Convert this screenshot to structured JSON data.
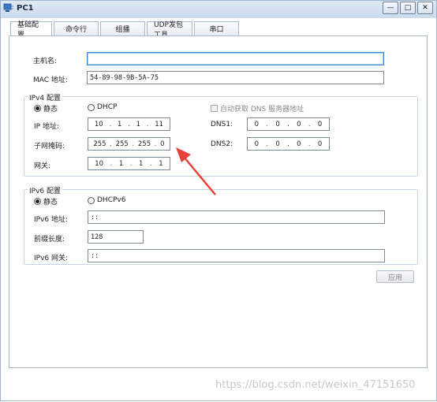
{
  "window": {
    "title": "PC1"
  },
  "tabs": [
    "基础配置",
    "命令行",
    "组播",
    "UDP发包工具",
    "串口"
  ],
  "basic": {
    "hostname_label": "主机名:",
    "hostname_value": "",
    "mac_label": "MAC 地址:",
    "mac_value": "54-89-98-9B-5A-75"
  },
  "ipv4": {
    "title": "IPv4 配置",
    "static_label": "静态",
    "dhcp_label": "DHCP",
    "auto_dns_label": "自动获取 DNS 服务器地址",
    "ip_label": "IP 地址:",
    "ip": [
      "10",
      "1",
      "1",
      "11"
    ],
    "mask_label": "子网掩码:",
    "mask": [
      "255",
      "255",
      "255",
      "0"
    ],
    "gateway_label": "网关:",
    "gateway": [
      "10",
      "1",
      "1",
      "1"
    ],
    "dns1_label": "DNS1:",
    "dns1": [
      "0",
      "0",
      "0",
      "0"
    ],
    "dns2_label": "DNS2:",
    "dns2": [
      "0",
      "0",
      "0",
      "0"
    ]
  },
  "ipv6": {
    "title": "IPv6 配置",
    "static_label": "静态",
    "dhcp_label": "DHCPv6",
    "addr_label": "IPv6 地址:",
    "addr_value": "::",
    "prefix_label": "前缀长度:",
    "prefix_value": "128",
    "gateway_label": "IPv6 网关:",
    "gateway_value": "::"
  },
  "apply_label": "应用",
  "watermark": "https://blog.csdn.net/weixin_47151650",
  "colors": {
    "arrow": "#e8413a",
    "focus_border": "#3a86d6"
  }
}
